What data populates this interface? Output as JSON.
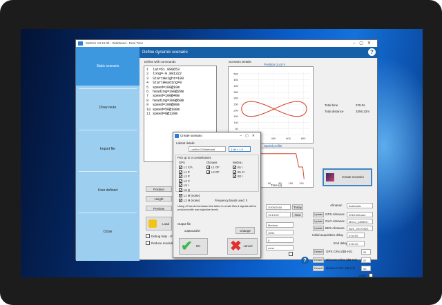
{
  "window": {
    "title": "SatGen V3.15.0b - Wideband - Real Time"
  },
  "sidebar": {
    "items": [
      "Static scenario",
      "Draw route",
      "Import file",
      "User defined",
      "Close"
    ]
  },
  "header": {
    "title": "Define dynamic scenario"
  },
  "commands": {
    "label": "Define with commands",
    "lines": [
      "lat=51.999653",
      "long=-0.991322",
      "StartHeight=100",
      "StartHeading=0",
      "speed=100@10m",
      "heading=180@20m",
      "speed=100@40m",
      "heading=300@60m",
      "speed=100@80m",
      "speed=50@100m",
      "speed=0@120m"
    ]
  },
  "left_buttons": {
    "position": "Position",
    "height": "Height",
    "preview": "Preview",
    "load": "Load",
    "debug": "Debug help - ch",
    "reduce": "Reduce resolutio"
  },
  "details": {
    "label": "Scenario Details",
    "plot_title": "Position (x,y) m",
    "speed_title": "Speed profile",
    "speed_xlabel": "Time (s)",
    "total_time_label": "Total time",
    "total_time": "378.0s",
    "total_distance_label": "Total distance",
    "total_distance": "3356.32m",
    "create_button": "Create scenario"
  },
  "chart_data": [
    {
      "type": "line",
      "title": "Position (x,y) m",
      "x_ticks": [
        "200",
        "400",
        "600",
        "800"
      ],
      "y_ticks": [
        "0",
        "50",
        "100",
        "150",
        "200",
        "250",
        "300",
        "350",
        "400",
        "450",
        "500"
      ],
      "series": [
        {
          "values": "figure-eight route"
        }
      ]
    },
    {
      "type": "line",
      "title": "Speed profile",
      "x_ticks": [
        "20",
        "40",
        "60",
        "80",
        "100",
        "120"
      ],
      "xlabel": "Time (s)"
    }
  ],
  "settings": {
    "date": "20/05/2018",
    "today": "Today",
    "time": "13:14:25",
    "now": "Now",
    "field1": "Medium",
    "field2": "10Hz",
    "field3": "5",
    "field4": "none"
  },
  "almanac": {
    "label": "Almanac",
    "value": "Automatic",
    "rows": [
      {
        "btn": "Update",
        "label": "GPS Almanac",
        "value": "2018-363.alm"
      },
      {
        "btn": "Update",
        "label": "GLO Almanac",
        "value": "MCCJ_180509.."
      },
      {
        "btn": "Update",
        "label": "BDS Almanac",
        "value": "BDS_20170922.."
      }
    ],
    "acq_label": "Initial acquisition delay",
    "acq_value": "0:04:00",
    "end_label": "End delay",
    "end_value": "0:00:10"
  },
  "cno": {
    "rows": [
      {
        "btn": "Default",
        "label": "GPS C/No (dB-Hz)",
        "value": "51"
      },
      {
        "btn": "Default",
        "label": "Glonass C/No (dB-Hz)",
        "value": "57"
      },
      {
        "btn": "Default",
        "label": "Beidou C/No (dB-Hz)",
        "value": "53"
      }
    ],
    "more": "more"
  },
  "dialog": {
    "title": "Create scenario",
    "labsat_label": "LabSat details",
    "labsat_value": "LabSat 3 Wideband",
    "bits_value": "1 bit + 1.9",
    "pick_label": "Pick up to 3 constellations",
    "gps_label": "GPS",
    "glonass_label": "Glonass",
    "beidou_label": "BeiDou",
    "gps_items": [
      "L1 C/A",
      "L1 P",
      "L2 P",
      "L2 C",
      "L5 I",
      "L5 Q"
    ],
    "glo_items": [
      "L1 OF",
      "L2 OF"
    ],
    "bds_items": [
      "B1 I",
      "B1 2I",
      "B2 I"
    ],
    "extra_items": [
      "L1 M (noise)",
      "L2 M (noise)"
    ],
    "bands_used": "Frequency bands used: 0",
    "note": "Using >2 bands increases time taken to create files & signals will be produced with max sig/noise levels",
    "output_label": "Output file",
    "output_value": "output153fv/",
    "change": "Change",
    "ok": "OK",
    "cancel": "cancel"
  }
}
